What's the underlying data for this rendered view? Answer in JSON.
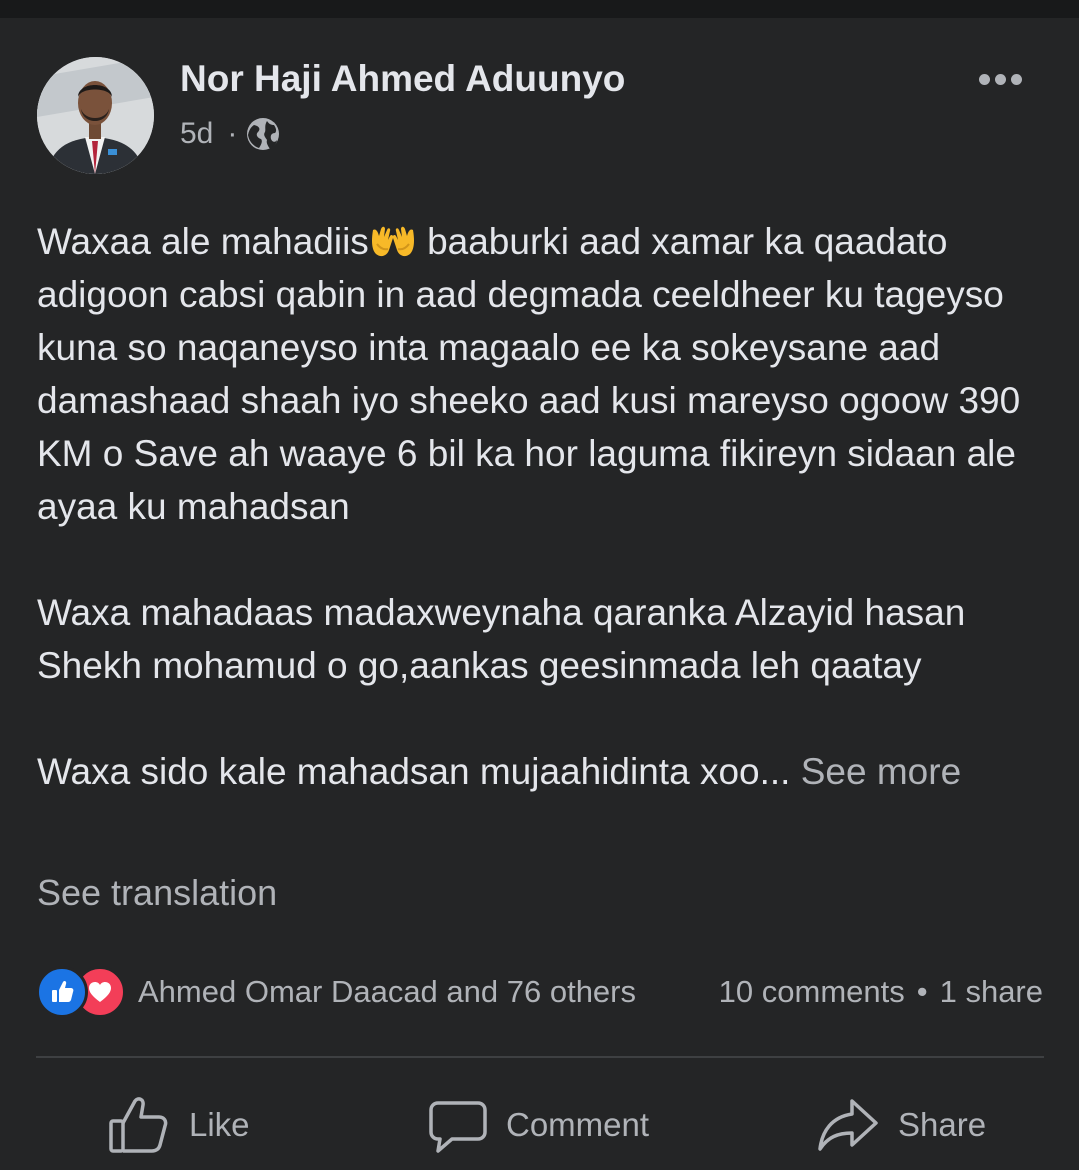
{
  "post": {
    "author": "Nor Haji Ahmed Aduunyo",
    "time": "5d",
    "separator": "·",
    "audience_icon": "globe-icon",
    "paragraph1_a": "Waxaa ale mahadiis",
    "paragraph1_emoji": "palms-up-together-emoji",
    "paragraph1_b": " baaburki aad xamar ka qaadato adigoon cabsi qabin in aad degmada ceeldheer ku tageyso kuna so naqaneyso inta magaalo ee ka sokeysane aad damashaad shaah iyo sheeko aad kusi mareyso ogoow 390 KM o Save ah waaye 6 bil ka hor laguma fikireyn sidaan ale ayaa ku mahadsan",
    "paragraph2": "Waxa mahadaas madaxweynaha qaranka Alzayid hasan Shekh mohamud o go,aankas geesinmada leh qaatay",
    "paragraph3": "Waxa sido kale mahadsan mujaahidinta xoo...",
    "see_more": "See more",
    "see_translation": "See translation"
  },
  "reactions": {
    "icons": [
      "like-reaction-icon",
      "love-reaction-icon"
    ],
    "summary": "Ahmed Omar Daacad and 76 others",
    "comments": "10 comments",
    "bullet": "•",
    "shares": "1 share"
  },
  "actions": {
    "like": "Like",
    "comment": "Comment",
    "share": "Share"
  },
  "colors": {
    "background": "#242526",
    "text": "#e4e6eb",
    "secondary_text": "#b0b3b8",
    "like_blue": "#1b74e4",
    "love_red": "#f33e58"
  }
}
